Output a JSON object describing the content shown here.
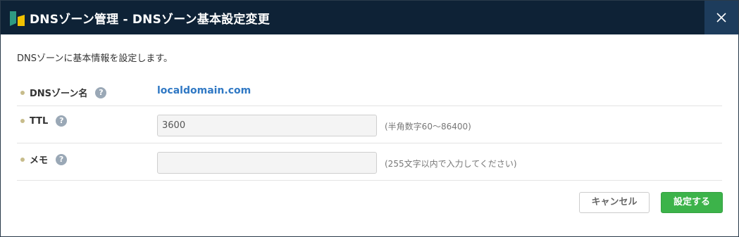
{
  "dialog": {
    "title": "DNSゾーン管理 - DNSゾーン基本設定変更",
    "intro": "DNSゾーンに基本情報を設定します。"
  },
  "fields": {
    "zone_name": {
      "label": "DNSゾーン名",
      "value": "localdomain.com"
    },
    "ttl": {
      "label": "TTL",
      "value": "3600",
      "hint": "(半角数字60～86400)"
    },
    "memo": {
      "label": "メモ",
      "value": "",
      "hint": "(255文字以内で入力してください)"
    }
  },
  "help_glyph": "?",
  "buttons": {
    "cancel": "キャンセル",
    "submit": "設定する"
  },
  "colors": {
    "header_bg": "#0e2236",
    "close_bg": "#1d3c5c",
    "link": "#2f78c4",
    "submit_bg": "#3cb34a",
    "bullet": "#c7bc8b"
  },
  "icons": {
    "logo": "service-logo-icon",
    "close": "close-icon",
    "help": "help-icon"
  }
}
